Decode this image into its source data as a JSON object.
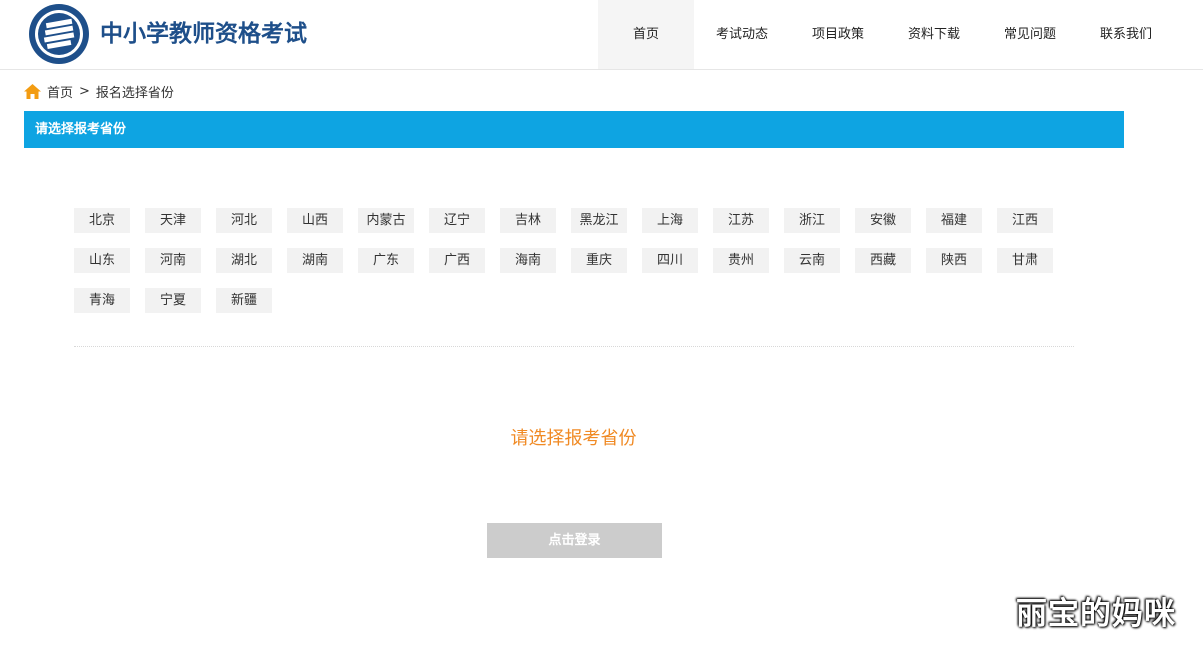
{
  "header": {
    "site_title": "中小学教师资格考试",
    "nav": [
      "首页",
      "考试动态",
      "项目政策",
      "资料下载",
      "常见问题",
      "联系我们"
    ],
    "active_nav": "首页"
  },
  "breadcrumb": {
    "home": "首页",
    "separator": ">",
    "current": "报名选择省份"
  },
  "section": {
    "title": "请选择报考省份"
  },
  "provinces": [
    [
      "北京",
      "天津",
      "河北",
      "山西",
      "内蒙古",
      "辽宁",
      "吉林",
      "黑龙江",
      "上海",
      "江苏",
      "浙江",
      "安徽",
      "福建",
      "江西"
    ],
    [
      "山东",
      "河南",
      "湖北",
      "湖南",
      "广东",
      "广西",
      "海南",
      "重庆",
      "四川",
      "贵州",
      "云南",
      "西藏",
      "陕西",
      "甘肃"
    ],
    [
      "青海",
      "宁夏",
      "新疆"
    ]
  ],
  "prompt": "请选择报考省份",
  "login_button": "点击登录",
  "watermark": "丽宝的妈咪",
  "colors": {
    "accent_bar": "#0ea4e2",
    "title_blue": "#1e4f8a",
    "prompt_orange": "#f08a24",
    "home_icon": "#f39c12",
    "button_disabled": "#cccccc"
  }
}
